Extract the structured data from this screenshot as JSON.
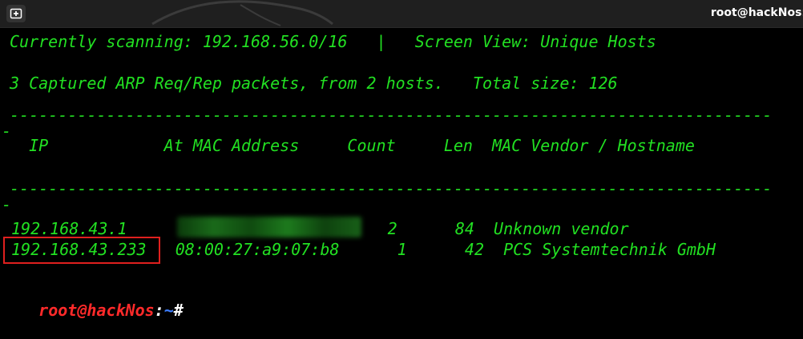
{
  "window": {
    "title": "root@hackNos:"
  },
  "header": {
    "scanning_line": "Currently scanning: 192.168.56.0/16   |   Screen View: Unique Hosts",
    "summary_line": "3 Captured ARP Req/Rep packets, from 2 hosts.   Total size: 126"
  },
  "separator": "-------------------------------------------------------------------------------",
  "separator_tail": "-",
  "table": {
    "header_line": "  IP            At MAC Address     Count     Len  MAC Vendor / Hostname"
  },
  "rows": [
    {
      "line": "192.168.43.1                           2      84  Unknown vendor",
      "mac_redacted": true
    },
    {
      "line": "192.168.43.233   08:00:27:a9:07:b8      1      42  PCS Systemtechnik GmbH",
      "highlighted": true
    }
  ],
  "prompt": {
    "user": "root@hackNos",
    "colon": ":",
    "path": "~",
    "symbol": "#"
  },
  "colors": {
    "terminal_text": "#22e022",
    "prompt_user": "#ff2a2a",
    "prompt_path": "#3c7dff",
    "highlight_border": "#e0201e",
    "background": "#000000"
  },
  "icons": {
    "new_tab": "new-tab-icon"
  }
}
